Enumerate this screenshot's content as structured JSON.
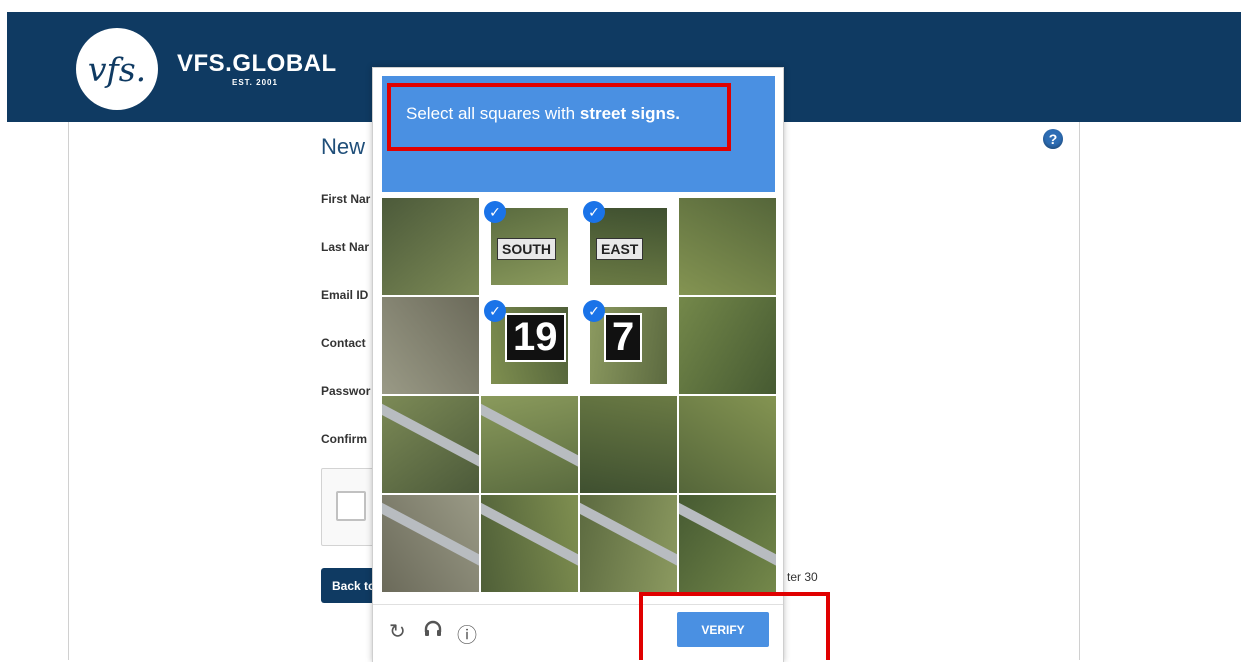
{
  "header": {
    "logo_mark": "vfs.",
    "brand": "VFS.GLOBAL",
    "brand_sub": "EST. 2001"
  },
  "form": {
    "title": "New",
    "labels": [
      "First Nar",
      "Last Nar",
      "Email ID",
      "Contact",
      "Passwor",
      "Confirm"
    ],
    "back_button": "Back to",
    "note": "ter 30",
    "help": "?"
  },
  "captcha": {
    "instruction_prefix": "Select all squares with",
    "instruction_bold": "street signs.",
    "tiles": [
      {
        "row": 0,
        "col": 0,
        "selected": false
      },
      {
        "row": 0,
        "col": 1,
        "selected": true,
        "sign": "SOUTH"
      },
      {
        "row": 0,
        "col": 2,
        "selected": true,
        "sign": "EAST"
      },
      {
        "row": 0,
        "col": 3,
        "selected": false
      },
      {
        "row": 1,
        "col": 0,
        "selected": false
      },
      {
        "row": 1,
        "col": 1,
        "selected": true,
        "sign": "19"
      },
      {
        "row": 1,
        "col": 2,
        "selected": true,
        "sign": "7"
      },
      {
        "row": 1,
        "col": 3,
        "selected": false
      },
      {
        "row": 2,
        "col": 0,
        "selected": false
      },
      {
        "row": 2,
        "col": 1,
        "selected": false
      },
      {
        "row": 2,
        "col": 2,
        "selected": false
      },
      {
        "row": 2,
        "col": 3,
        "selected": false
      },
      {
        "row": 3,
        "col": 0,
        "selected": false
      },
      {
        "row": 3,
        "col": 1,
        "selected": false
      },
      {
        "row": 3,
        "col": 2,
        "selected": false
      },
      {
        "row": 3,
        "col": 3,
        "selected": false
      }
    ],
    "reload_icon": "↻",
    "audio_icon": "🎧",
    "info_icon": "ⓘ",
    "verify_label": "VERIFY"
  },
  "colors": {
    "header_bg": "#0f3a62",
    "captcha_blue": "#4a90e2",
    "highlight_red": "#e00000"
  }
}
